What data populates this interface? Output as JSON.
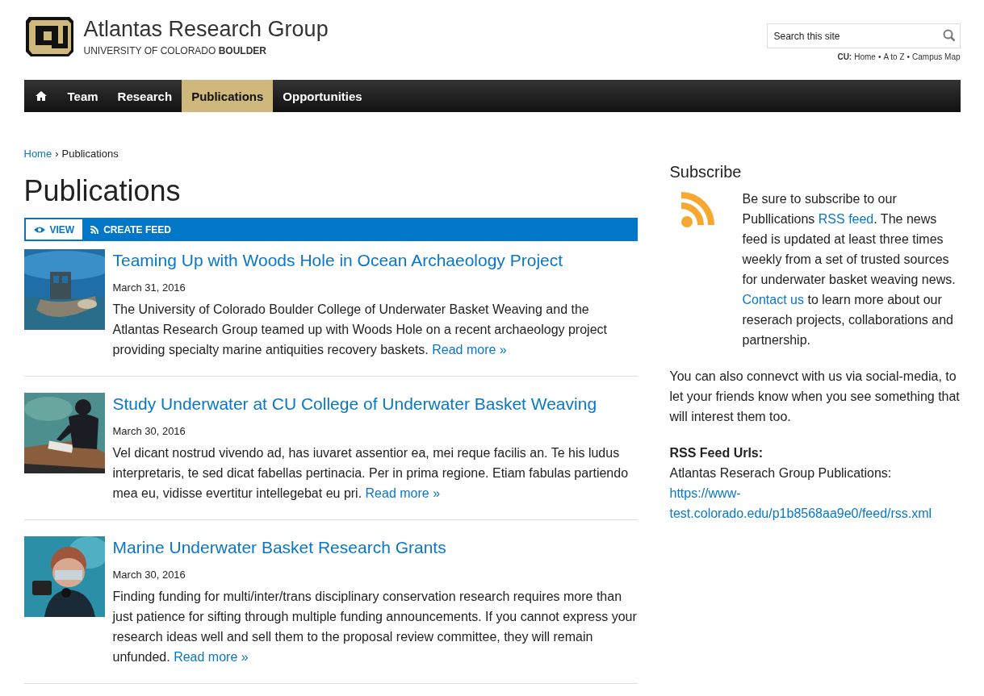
{
  "header": {
    "site_title": "Atlantas Research Group",
    "subtitle": "UNIVERSITY OF COLORADO ",
    "subtitle_bold": "BOULDER",
    "search": {
      "placeholder": "Search this site"
    },
    "cu_label": "CU:",
    "cu_links": [
      "Home",
      "A to Z",
      "Campus Map"
    ],
    "separator": "•"
  },
  "nav": [
    {
      "kind": "home",
      "selected": false
    },
    {
      "kind": "text",
      "label": "Team",
      "selected": false
    },
    {
      "kind": "text",
      "label": "Research",
      "selected": false
    },
    {
      "kind": "text",
      "label": "Publications",
      "selected": true
    },
    {
      "kind": "text",
      "label": "Opportunities",
      "selected": false
    }
  ],
  "breadcrumb": {
    "items": [
      "Home"
    ],
    "separator": "›",
    "current": "Publications"
  },
  "page_title": "Publications",
  "tabs": [
    {
      "kind": "view",
      "label": "VIEW",
      "selected": true
    },
    {
      "kind": "feed",
      "label": "CREATE FEED",
      "selected": false
    }
  ],
  "articles": [
    {
      "kind": "picture",
      "title": "Teaming Up with Woods Hole in Ocean Archaeology Project",
      "date": "March 31, 2016",
      "summary": "The University of Colorado Boulder College of Underwater Basket Weaving and the Atlantas Research Group teamed up with Woods Hole on a recent archaeology project providing specialty marine antiquities recovery baskets.",
      "read_more": "Read more »"
    },
    {
      "kind": "picture",
      "title": "Study Underwater at CU College of Underwater Basket Weaving",
      "date": "March 30, 2016",
      "summary": "Vel dicant nostrud vivendo ad, has iuvaret assentior ea, mei reque facilis an. Te his ludus interpretaris, te sed dicat fabellas pertinacia. Per in prima regione. Etiam fabulas partiendo mea eu, vidisse evertitur intellegebat eu pri.",
      "read_more": "Read more »"
    },
    {
      "kind": "picture",
      "title": "Marine Underwater Basket Research Grants",
      "date": "March 30, 2016",
      "summary": "Finding funding for multi/inter/trans disciplinary conservation research requires more than just patience for sifting through multiple funding announcements. If you cannot express your research ideas well and sell them to the proposal review committee, they will remain unfunded.",
      "read_more": "Read more »"
    }
  ],
  "sidebar": {
    "heading": "Subscribe",
    "intro": [
      {
        "kind": "text",
        "text": "Be sure to subscribe to our Publlications "
      },
      {
        "kind": "link",
        "text": "RSS feed"
      },
      {
        "kind": "text",
        "text": ". The news feed is updated at least three times weekly from a set of trusted sources for underwater basket weaving news. "
      },
      {
        "kind": "link",
        "text": "Contact us"
      },
      {
        "kind": "text",
        "text": " to learn more about our reserach projects, collaborations and partnership."
      }
    ],
    "social": "You can also  connevct with us via social-media, to let your friends know when you see something that will interest them too.",
    "feeds_heading": "RSS Feed Urls:",
    "feed_name": "Atlantas Reserach Group Publications:",
    "feed_url": "https://www-test.colorado.edu/p1b8568aa9e0/feed/rss.xml"
  }
}
